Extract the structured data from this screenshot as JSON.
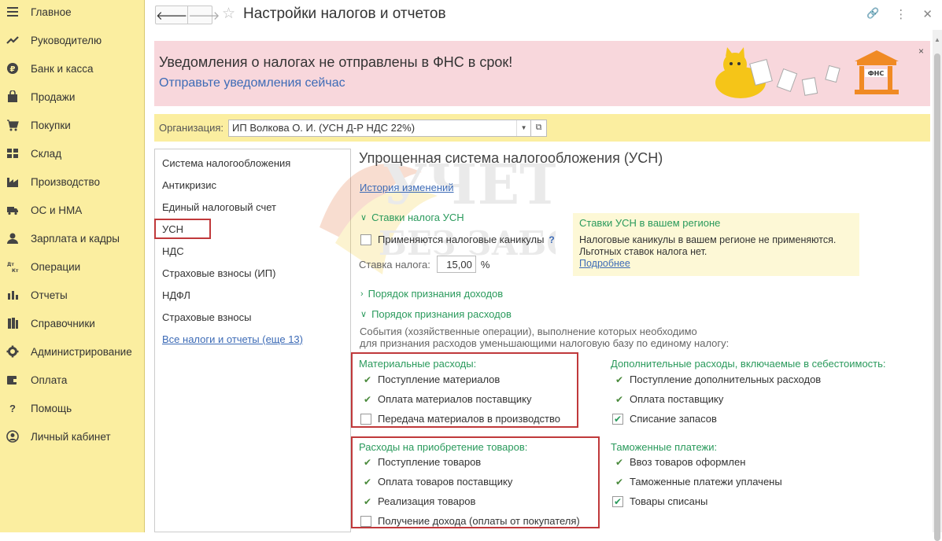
{
  "sidebar": {
    "items": [
      {
        "label": "Главное",
        "icon": "menu-icon"
      },
      {
        "label": "Руководителю",
        "icon": "trend-icon"
      },
      {
        "label": "Банк и касса",
        "icon": "ruble-coin-icon"
      },
      {
        "label": "Продажи",
        "icon": "shopping-bag-icon"
      },
      {
        "label": "Покупки",
        "icon": "cart-icon"
      },
      {
        "label": "Склад",
        "icon": "warehouse-icon"
      },
      {
        "label": "Производство",
        "icon": "factory-icon"
      },
      {
        "label": "ОС и НМА",
        "icon": "truck-icon"
      },
      {
        "label": "Зарплата и кадры",
        "icon": "person-icon"
      },
      {
        "label": "Операции",
        "icon": "dt-kt-icon"
      },
      {
        "label": "Отчеты",
        "icon": "bar-chart-icon"
      },
      {
        "label": "Справочники",
        "icon": "books-icon"
      },
      {
        "label": "Администрирование",
        "icon": "gear-icon"
      },
      {
        "label": "Оплата",
        "icon": "wallet-icon"
      },
      {
        "label": "Помощь",
        "icon": "question-icon"
      },
      {
        "label": "Личный кабинет",
        "icon": "account-icon"
      }
    ]
  },
  "header": {
    "title": "Настройки налогов и отчетов",
    "back": "🡐",
    "forward": "🡒",
    "star": "☆",
    "link_icon": "🔗",
    "more_icon": "⋮",
    "close_icon": "✕"
  },
  "banner": {
    "headline": "Уведомления о налогах не отправлены в ФНС в срок!",
    "link": "Отправьте уведомления сейчас",
    "close": "×",
    "fns_label": "ФНС"
  },
  "org": {
    "label": "Организация:",
    "value": "ИП Волкова О. И. (УСН Д-Р НДС 22%)"
  },
  "leftnav": {
    "items": [
      "Система налогообложения",
      "Антикризис",
      "Единый налоговый счет",
      "УСН",
      "НДС",
      "Страховые взносы (ИП)",
      "НДФЛ",
      "Страховые взносы"
    ],
    "selected": "УСН",
    "all_link": "Все налоги и отчеты (еще 13)"
  },
  "main": {
    "title": "Упрощенная система налогообложения (УСН)",
    "history_link": "История изменений",
    "rates_group": "Ставки налога УСН",
    "tax_holidays_label": "Применяются налоговые каникулы",
    "tax_holidays_help": "?",
    "rate_label": "Ставка налога:",
    "rate_value": "15,00",
    "rate_unit": "%",
    "income_group": "Порядок признания доходов",
    "expense_group": "Порядок признания расходов",
    "description_line1": "События (хозяйственные операции), выполнение которых необходимо",
    "description_line2": "для признания расходов уменьшающими налоговую базу по единому налогу:"
  },
  "info": {
    "heading": "Ставки УСН в вашем регионе",
    "line1": "Налоговые каникулы в вашем регионе не применяются.",
    "line2": "Льготных ставок налога нет.",
    "link": "Подробнее"
  },
  "materials": {
    "heading": "Материальные расходы:",
    "items": [
      {
        "label": "Поступление материалов",
        "state": "tick"
      },
      {
        "label": "Оплата материалов поставщику",
        "state": "tick"
      },
      {
        "label": "Передача материалов в производство",
        "state": "unchecked"
      }
    ]
  },
  "additional": {
    "heading": "Дополнительные расходы, включаемые в себестоимость:",
    "items": [
      {
        "label": "Поступление дополнительных расходов",
        "state": "tick"
      },
      {
        "label": "Оплата поставщику",
        "state": "tick"
      },
      {
        "label": "Списание запасов",
        "state": "checked"
      }
    ]
  },
  "goods": {
    "heading": "Расходы на приобретение товаров:",
    "items": [
      {
        "label": "Поступление товаров",
        "state": "tick"
      },
      {
        "label": "Оплата товаров поставщику",
        "state": "tick"
      },
      {
        "label": "Реализация товаров",
        "state": "tick"
      },
      {
        "label": "Получение дохода (оплаты от покупателя)",
        "state": "unchecked"
      }
    ]
  },
  "customs": {
    "heading": "Таможенные платежи:",
    "items": [
      {
        "label": "Ввоз товаров оформлен",
        "state": "tick"
      },
      {
        "label": "Таможенные платежи уплачены",
        "state": "tick"
      },
      {
        "label": "Товары списаны",
        "state": "checked"
      }
    ]
  },
  "watermark": {
    "line1": "УЧЕТ",
    "line2": "БЕЗ ЗАБОТ"
  },
  "colors": {
    "sidebar_bg": "#fbeea0",
    "banner_bg": "#f8d7dc",
    "accent_green": "#2a9a5c",
    "link_blue": "#3d6bb6",
    "highlight_red": "#c0393b"
  }
}
